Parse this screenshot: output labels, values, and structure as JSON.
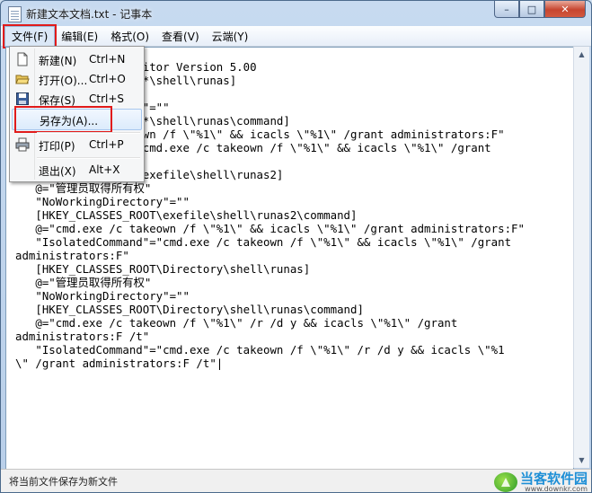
{
  "window": {
    "title": "新建文本文档.txt - 记事本",
    "controls": {
      "minimize": "–",
      "maximize": "□",
      "close": "✕"
    }
  },
  "menubar": {
    "items": [
      "文件(F)",
      "编辑(E)",
      "格式(O)",
      "查看(V)",
      "云端(Y)"
    ]
  },
  "file_menu": {
    "items": [
      {
        "label": "新建(N)",
        "shortcut": "Ctrl+N",
        "icon": "new-file-icon"
      },
      {
        "label": "打开(O)...",
        "shortcut": "Ctrl+O",
        "icon": "open-folder-icon"
      },
      {
        "label": "保存(S)",
        "shortcut": "Ctrl+S",
        "icon": "save-disk-icon"
      },
      {
        "label": "另存为(A)...",
        "shortcut": "",
        "icon": ""
      },
      {
        "label": "打印(P)",
        "shortcut": "Ctrl+P",
        "icon": "printer-icon"
      },
      {
        "label": "退出(X)",
        "shortcut": "Alt+X",
        "icon": ""
      }
    ],
    "highlighted": "另存为(A)..."
  },
  "editor": {
    "content": "              ry Editor Version 5.00\n              ROOT\\*\\shell\\runas]\n              有权\"\n              ctory\"=\"\"\n              ROOT\\*\\shell\\runas\\command]\n              takeown /f \\\"%1\\\" && icacls \\\"%1\\\" /grant administrators:F\"\n              nd\"=\"cmd.exe /c takeown /f \\\"%1\\\" && icacls \\\"%1\\\" /grant\n\n              ROOT\\exefile\\shell\\runas2]\n   @=\"管理员取得所有权\"\n   \"NoWorkingDirectory\"=\"\"\n   [HKEY_CLASSES_ROOT\\exefile\\shell\\runas2\\command]\n   @=\"cmd.exe /c takeown /f \\\"%1\\\" && icacls \\\"%1\\\" /grant administrators:F\"\n   \"IsolatedCommand\"=\"cmd.exe /c takeown /f \\\"%1\\\" && icacls \\\"%1\\\" /grant\nadministrators:F\"\n   [HKEY_CLASSES_ROOT\\Directory\\shell\\runas]\n   @=\"管理员取得所有权\"\n   \"NoWorkingDirectory\"=\"\"\n   [HKEY_CLASSES_ROOT\\Directory\\shell\\runas\\command]\n   @=\"cmd.exe /c takeown /f \\\"%1\\\" /r /d y && icacls \\\"%1\\\" /grant\nadministrators:F /t\"\n   \"IsolatedCommand\"=\"cmd.exe /c takeown /f \\\"%1\\\" /r /d y && icacls \\\"%1\n\\\" /grant administrators:F /t\"|"
  },
  "statusbar": {
    "text": "将当前文件保存为新文件"
  },
  "watermark": {
    "name": "当客软件园",
    "url": "www.downkr.com"
  }
}
